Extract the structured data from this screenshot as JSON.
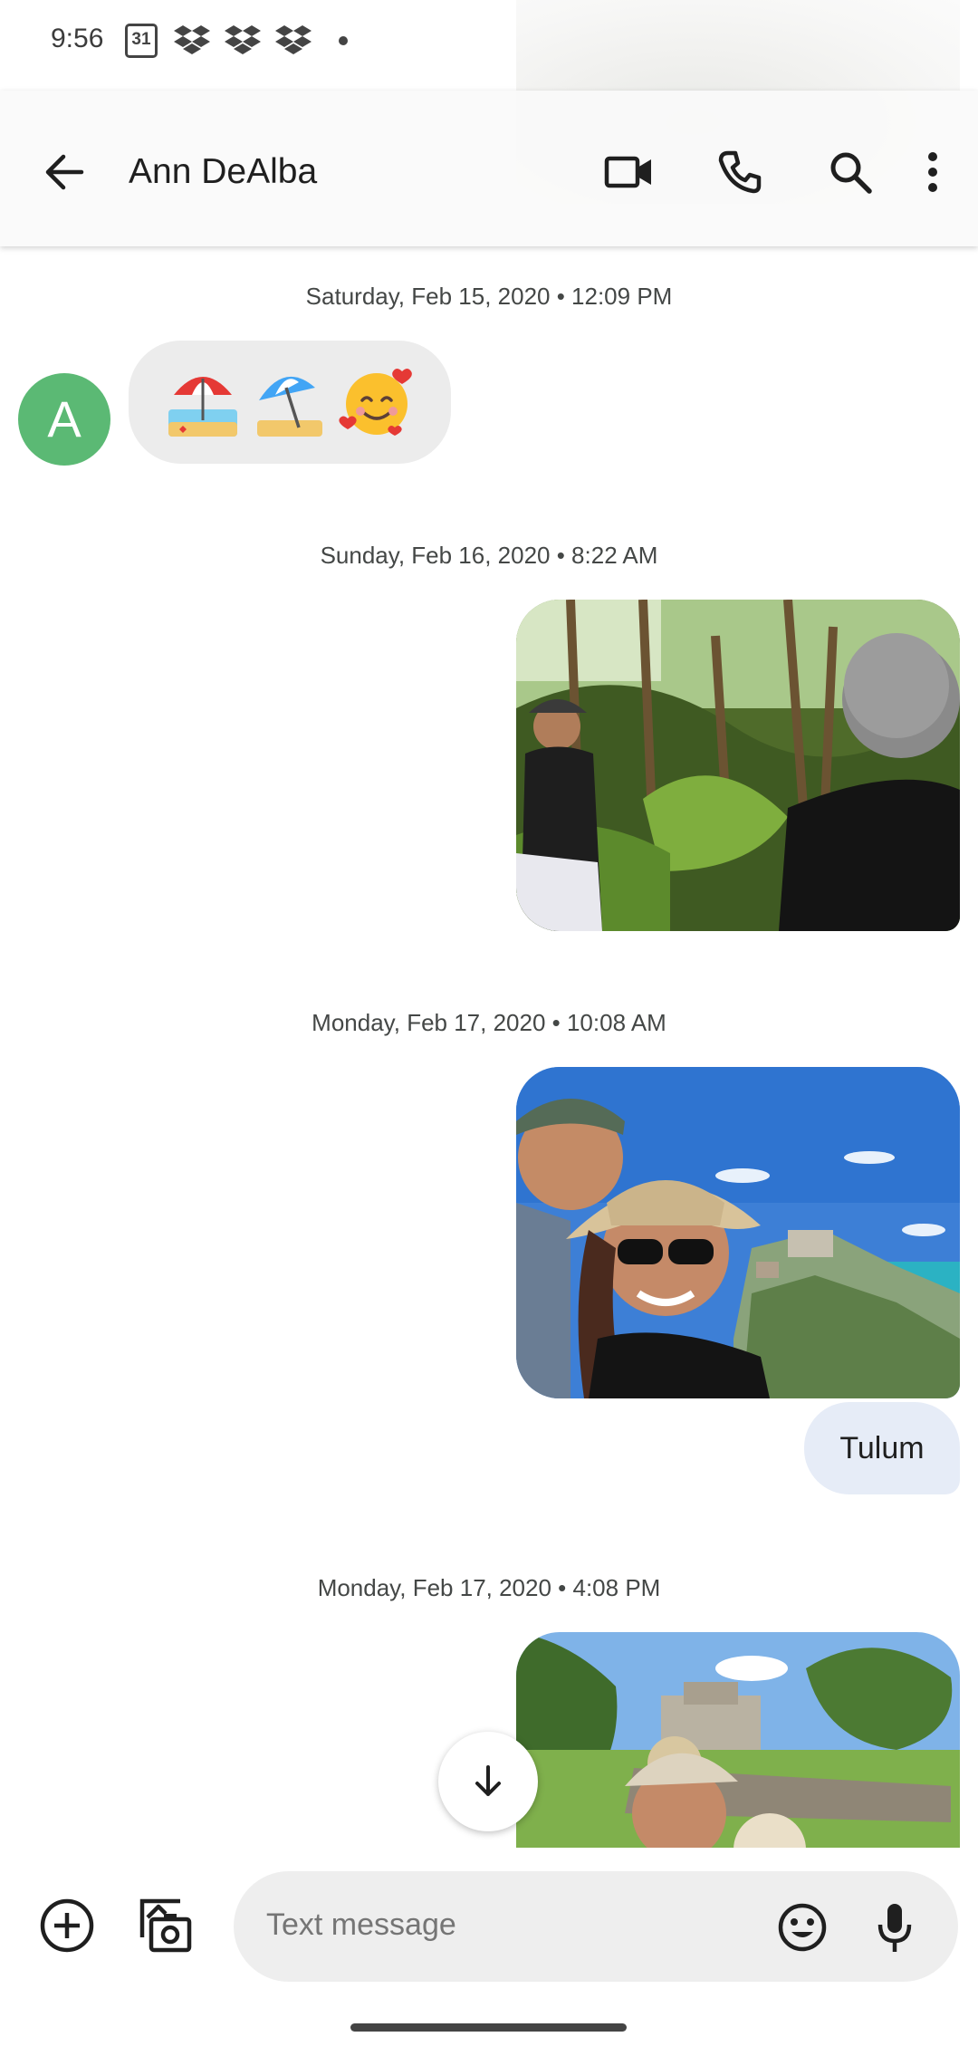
{
  "status_bar": {
    "time": "9:56",
    "calendar_day": "31",
    "icons": [
      "calendar-icon",
      "dropbox-icon",
      "dropbox-icon",
      "dropbox-icon",
      "notification-dot",
      "vibrate-icon",
      "wifi-icon",
      "battery-icon"
    ]
  },
  "header": {
    "contact_name": "Ann DeAlba",
    "actions": [
      "video-call-icon",
      "phone-icon",
      "search-icon",
      "more-icon"
    ]
  },
  "conversation": {
    "messages": [
      {
        "date": "Saturday, Feb 15, 2020 • 12:09 PM",
        "direction": "incoming",
        "sender_initial": "A",
        "content": [
          "beach-umbrella-emoji",
          "umbrella-on-ground-emoji",
          "smiling-face-with-hearts-emoji"
        ]
      },
      {
        "date": "Sunday, Feb 16, 2020 • 8:22 AM",
        "direction": "outgoing",
        "type": "photo"
      },
      {
        "date": "Monday, Feb 17, 2020 • 10:08 AM",
        "direction": "outgoing",
        "type": "photo",
        "caption": "Tulum"
      },
      {
        "date": "Monday, Feb 17, 2020 • 4:08 PM",
        "direction": "outgoing",
        "type": "photo"
      }
    ]
  },
  "compose": {
    "placeholder": "Text message"
  },
  "colors": {
    "avatar": "#5bb974",
    "incoming_bubble": "#ececec",
    "outgoing_bubble": "#e6ecf7",
    "compose_field": "#eeeeee"
  }
}
